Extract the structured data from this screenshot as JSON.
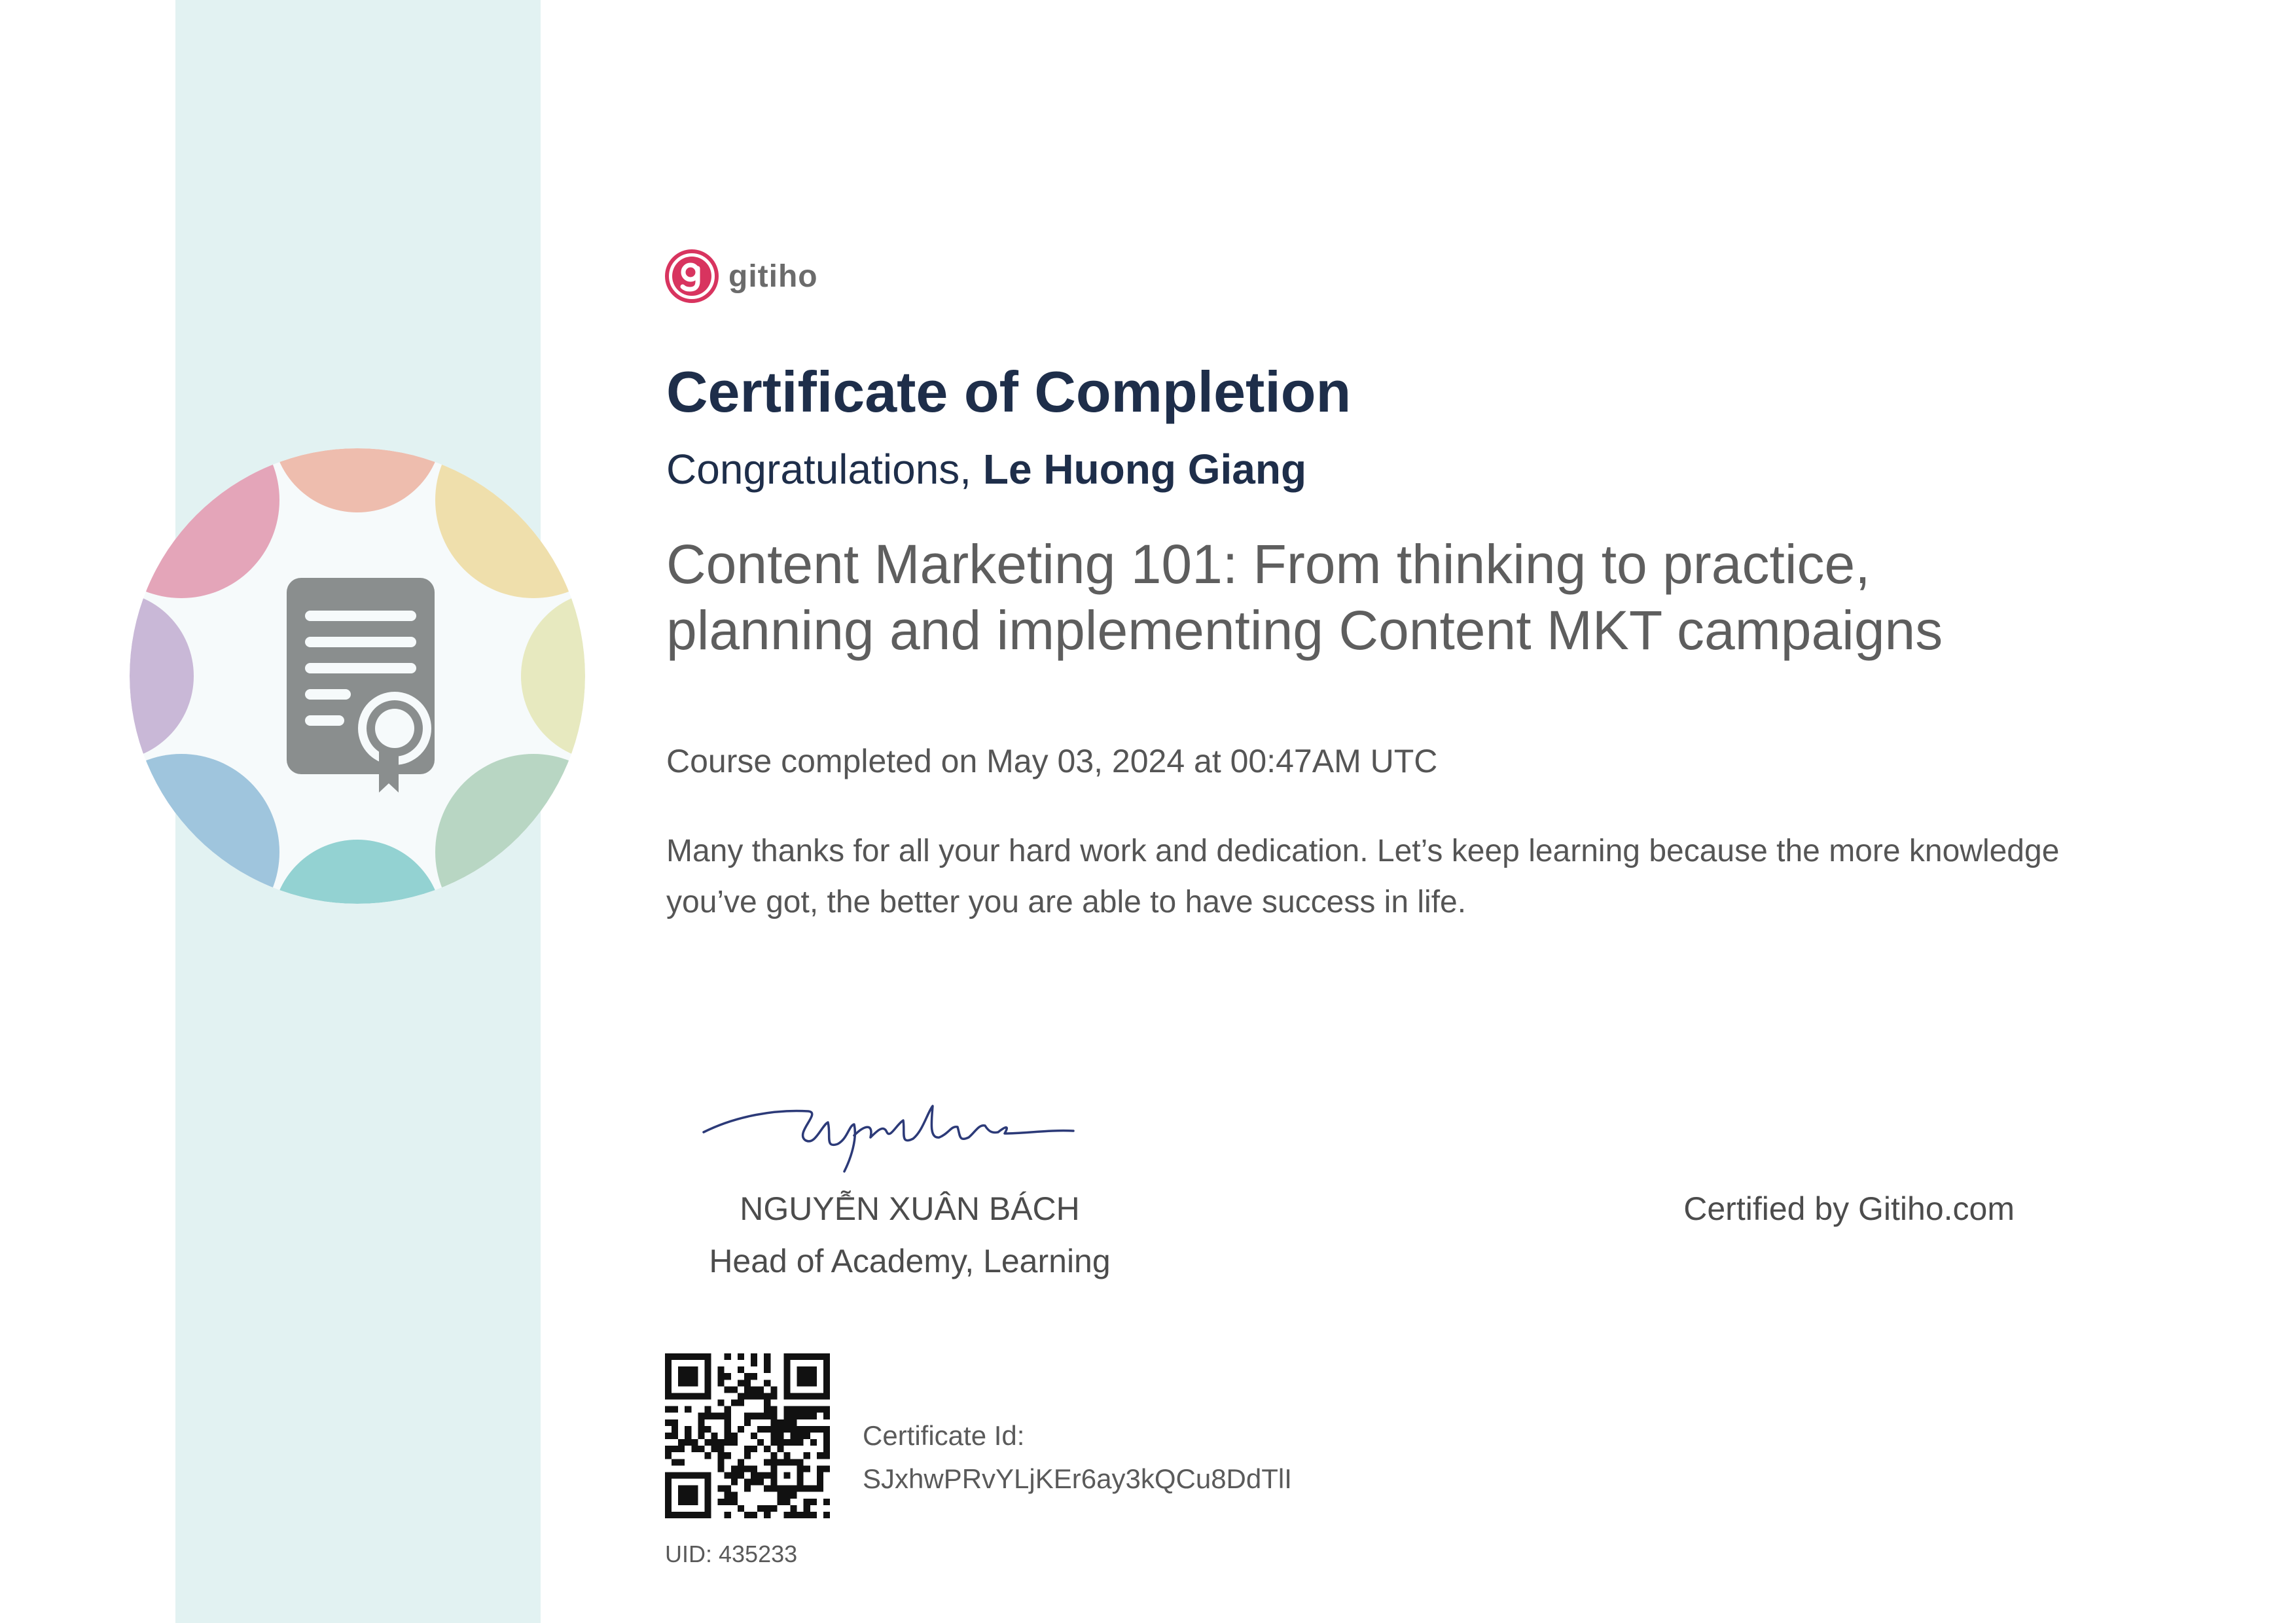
{
  "brand": {
    "logo_text": "gitiho",
    "logo_color": "#d8345f"
  },
  "certificate": {
    "title": "Certificate of Completion",
    "congrats_prefix": "Congratulations, ",
    "recipient": "Le Huong Giang",
    "course_title": "Content Marketing 101: From thinking to practice, planning and implementing Content MKT campaigns",
    "completed_text": "Course completed on May 03, 2024 at 00:47AM UTC",
    "message": "Many thanks for all your hard work and dedication. Let’s keep learning because the more knowledge you’ve got, the better you are able to have success in life."
  },
  "signatory": {
    "name": "NGUYỄN XUÂN BÁCH",
    "role": "Head of Academy, Learning"
  },
  "certified_by": "Certified by Gitiho.com",
  "verification": {
    "id_label": "Certificate Id:",
    "id_value": "SJxhwPRvYLjKEr6ay3kQCu8DdTlI",
    "uid": "UID: 435233"
  },
  "colors": {
    "stripe": "#e2f2f2",
    "heading": "#1e2e4a",
    "body_text": "#555555",
    "signature_ink": "#2c3a78"
  },
  "icons": {
    "emblem": "certificate-document-icon",
    "logo": "gitiho-g-icon"
  }
}
